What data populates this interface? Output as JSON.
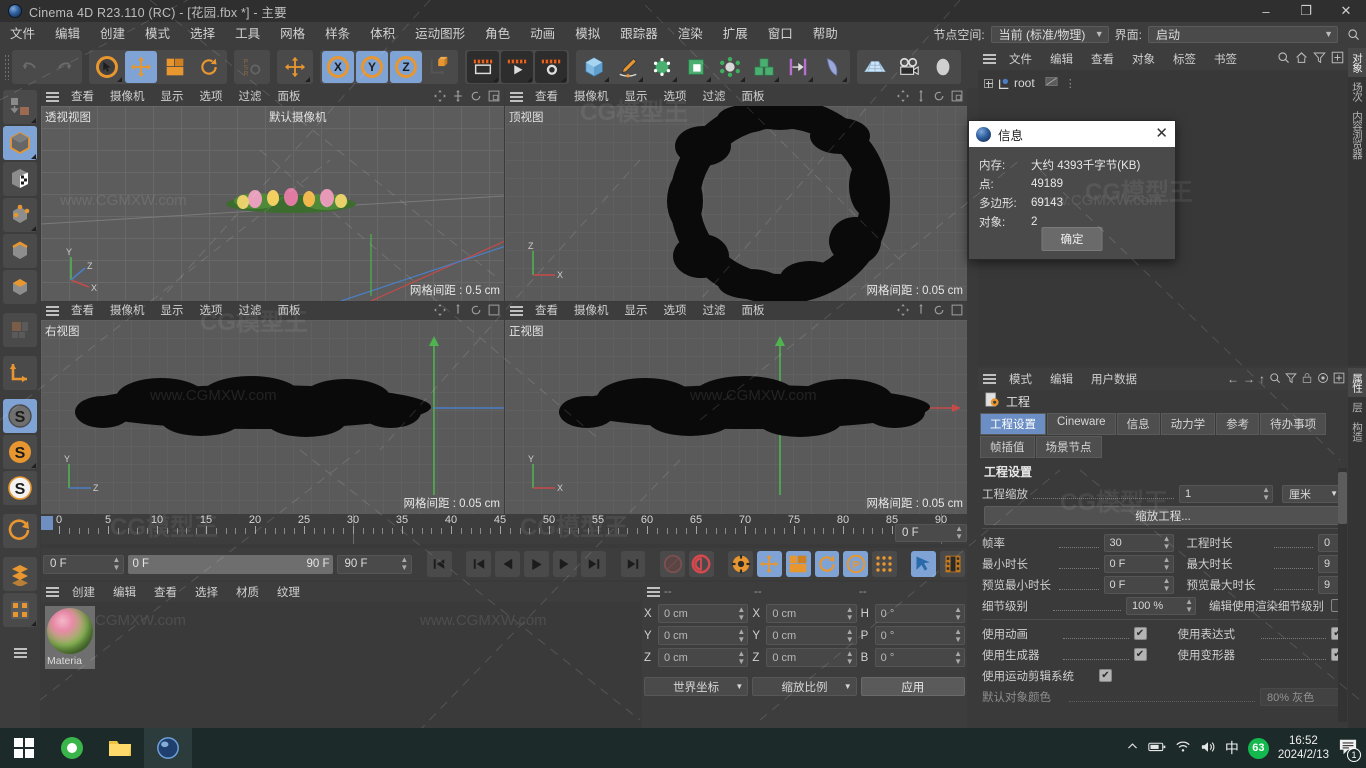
{
  "window": {
    "title": "Cinema 4D R23.110 (RC) - [花园.fbx *] - 主要",
    "minimize": "–",
    "maximize": "❐",
    "close": "✕"
  },
  "menubar": {
    "items": [
      "文件",
      "编辑",
      "创建",
      "模式",
      "选择",
      "工具",
      "网格",
      "样条",
      "体积",
      "运动图形",
      "角色",
      "动画",
      "模拟",
      "跟踪器",
      "渲染",
      "扩展",
      "窗口",
      "帮助"
    ],
    "node_space_label": "节点空间:",
    "node_space_value": "当前 (标准/物理)",
    "layout_label": "界面:",
    "layout_value": "启动",
    "search_icon": "search-icon"
  },
  "viewports": [
    {
      "name": "透视视图",
      "menus": [
        "查看",
        "摄像机",
        "显示",
        "选项",
        "过滤",
        "面板"
      ],
      "camera": "默认摄像机",
      "grid": "网格间距 : 0.5 cm"
    },
    {
      "name": "顶视图",
      "menus": [
        "查看",
        "摄像机",
        "显示",
        "选项",
        "过滤",
        "面板"
      ],
      "camera": "",
      "grid": "网格间距 : 0.05 cm"
    },
    {
      "name": "右视图",
      "menus": [
        "查看",
        "摄像机",
        "显示",
        "选项",
        "过滤",
        "面板"
      ],
      "camera": "",
      "grid": "网格间距 : 0.05 cm"
    },
    {
      "name": "正视图",
      "menus": [
        "查看",
        "摄像机",
        "显示",
        "选项",
        "过滤",
        "面板"
      ],
      "camera": "",
      "grid": "网格间距 : 0.05 cm"
    }
  ],
  "timeline": {
    "ticks": [
      "0",
      "5",
      "10",
      "15",
      "20",
      "25",
      "30",
      "35",
      "40",
      "45",
      "50",
      "55",
      "60",
      "65",
      "70",
      "75",
      "80",
      "85",
      "90"
    ],
    "current_frame": "0 F",
    "range_start": "0 F",
    "range_end": "90 F",
    "max_frame": "90 F",
    "right_frame": "0 F"
  },
  "material_manager": {
    "menus": [
      "创建",
      "编辑",
      "查看",
      "选择",
      "材质",
      "纹理"
    ],
    "materials": [
      {
        "name": "Materia"
      }
    ]
  },
  "coordinates": {
    "header": [
      "--",
      "--",
      "--"
    ],
    "rows": [
      {
        "pos_axis": "X",
        "pos": "0 cm",
        "size_axis": "X",
        "size": "0 cm",
        "rot_axis": "H",
        "rot": "0 °"
      },
      {
        "pos_axis": "Y",
        "pos": "0 cm",
        "size_axis": "Y",
        "size": "0 cm",
        "rot_axis": "P",
        "rot": "0 °"
      },
      {
        "pos_axis": "Z",
        "pos": "0 cm",
        "size_axis": "Z",
        "size": "0 cm",
        "rot_axis": "B",
        "rot": "0 °"
      }
    ],
    "coord_system": "世界坐标",
    "scale_mode": "缩放比例",
    "apply": "应用"
  },
  "object_manager": {
    "menus": [
      "文件",
      "编辑",
      "查看",
      "对象",
      "标签",
      "书签"
    ],
    "icons": [
      "search-icon",
      "home-icon",
      "filter-icon",
      "add-icon"
    ],
    "root_label": "root"
  },
  "attribute_manager": {
    "menus": [
      "模式",
      "编辑",
      "用户数据"
    ],
    "icons": [
      "back-icon",
      "forward-icon",
      "up-icon",
      "search-icon",
      "filter-icon",
      "lock-icon",
      "target-icon",
      "add-icon"
    ],
    "object_label": "工程",
    "tabs": [
      "工程设置",
      "Cineware",
      "信息",
      "动力学",
      "参考",
      "待办事项",
      "帧插值",
      "场景节点"
    ],
    "active_tab": "工程设置",
    "section_title": "工程设置",
    "project_scale_label": "工程缩放",
    "project_scale_value": "1",
    "project_scale_unit": "厘米",
    "scale_project_button": "缩放工程...",
    "fields": [
      {
        "label": "帧率",
        "value": "30",
        "label2": "工程时长",
        "value2": "0"
      },
      {
        "label": "最小时长",
        "value": "0 F",
        "label2": "最大时长",
        "value2": "9"
      },
      {
        "label": "预览最小时长",
        "value": "0 F",
        "label2": "预览最大时长",
        "value2": "9"
      }
    ],
    "lod_label": "细节级别",
    "lod_value": "100 %",
    "render_lod_label": "编辑使用渲染细节级别",
    "checks": [
      {
        "label": "使用动画",
        "checked": true,
        "label2": "使用表达式",
        "checked2": true
      },
      {
        "label": "使用生成器",
        "checked": true,
        "label2": "使用变形器",
        "checked2": true
      },
      {
        "label": "使用运动剪辑系统",
        "checked": true,
        "label2": "",
        "checked2": null
      }
    ],
    "last_label": "默认对象颜色",
    "last_value": "80% 灰色"
  },
  "right_tabs_top": [
    "对象",
    "场次",
    "内容浏览器"
  ],
  "right_tabs_bottom": [
    "属性",
    "层",
    "构造"
  ],
  "info_dialog": {
    "title": "信息",
    "close": "✕",
    "rows": [
      {
        "key": "内存:",
        "value": "大约 4393千字节(KB)"
      },
      {
        "key": "点:",
        "value": "49189"
      },
      {
        "key": "多边形:",
        "value": "69143"
      },
      {
        "key": "对象:",
        "value": "2"
      }
    ],
    "ok": "确定"
  },
  "toolbar": {
    "groups": [
      {
        "buttons": [
          {
            "name": "undo-icon",
            "glyph": "↶",
            "state": "disabled"
          },
          {
            "name": "redo-icon",
            "glyph": "↷",
            "state": "disabled"
          }
        ]
      },
      {
        "buttons": [
          {
            "name": "select-tool-icon",
            "glyph": "➤",
            "state": "normal"
          },
          {
            "name": "move-tool-icon",
            "glyph": "✥",
            "state": "selected"
          },
          {
            "name": "scale-tool-icon",
            "glyph": "▧",
            "state": "normal"
          },
          {
            "name": "rotate-tool-icon",
            "glyph": "⟳",
            "state": "normal"
          }
        ]
      },
      {
        "buttons": [
          {
            "name": "psr-icon",
            "glyph": "PSR",
            "state": "normal"
          },
          {
            "name": "move-axis-icon",
            "glyph": "✥",
            "state": "normal"
          }
        ]
      },
      {
        "buttons": [
          {
            "name": "lock-x-icon",
            "glyph": "X",
            "state": "selected"
          },
          {
            "name": "lock-y-icon",
            "glyph": "Y",
            "state": "selected"
          },
          {
            "name": "lock-z-icon",
            "glyph": "Z",
            "state": "selected"
          },
          {
            "name": "world-coord-icon",
            "glyph": "⬚",
            "state": "normal"
          }
        ]
      },
      {
        "buttons": [
          {
            "name": "render-view-icon",
            "glyph": "▭",
            "state": "dark"
          },
          {
            "name": "render-region-icon",
            "glyph": "▶",
            "state": "dark"
          },
          {
            "name": "render-settings-icon",
            "glyph": "⚙",
            "state": "dark"
          }
        ]
      },
      {
        "buttons": [
          {
            "name": "cube-primitive-icon",
            "glyph": "◻",
            "state": "normal"
          },
          {
            "name": "spline-pen-icon",
            "glyph": "✒",
            "state": "normal"
          },
          {
            "name": "nurbs-icon",
            "glyph": "◫",
            "state": "normal"
          },
          {
            "name": "array-icon",
            "glyph": "◧",
            "state": "normal"
          },
          {
            "name": "symmetry-icon",
            "glyph": "✣",
            "state": "normal"
          },
          {
            "name": "mograph-icon",
            "glyph": "▩",
            "state": "normal"
          },
          {
            "name": "deformer-icon",
            "glyph": "⊢",
            "state": "normal"
          },
          {
            "name": "field-icon",
            "glyph": "◗",
            "state": "normal"
          }
        ]
      },
      {
        "buttons": [
          {
            "name": "floor-icon",
            "glyph": "▤",
            "state": "normal"
          },
          {
            "name": "camera-icon",
            "glyph": "📷",
            "state": "normal"
          },
          {
            "name": "light-icon",
            "glyph": "◍",
            "state": "normal"
          }
        ]
      }
    ]
  },
  "left_toolbar": [
    {
      "name": "make-editable-icon",
      "state": "normal"
    },
    {
      "name": "model-mode-icon",
      "state": "selected"
    },
    {
      "name": "texture-mode-icon",
      "state": "normal"
    },
    {
      "name": "point-mode-icon",
      "state": "normal"
    },
    {
      "name": "edge-mode-icon",
      "state": "normal"
    },
    {
      "name": "polygon-mode-icon",
      "state": "normal"
    },
    {
      "name": "uv-mode-icon",
      "state": "disabled"
    },
    {
      "name": "axis-mode-icon",
      "state": "normal"
    },
    {
      "name": "snap-enable-icon",
      "state": "selected"
    },
    {
      "name": "snap-settings-icon",
      "state": "normal"
    },
    {
      "name": "quantize-icon",
      "state": "normal"
    },
    {
      "name": "workplane-icon",
      "state": "normal"
    },
    {
      "name": "layout-icon",
      "state": "normal"
    },
    {
      "name": "render-queue-icon",
      "state": "normal"
    }
  ],
  "transport": {
    "buttons": [
      {
        "name": "goto-start-button",
        "glyph": "|◀",
        "state": "normal"
      },
      {
        "name": "prev-keyframe-button",
        "glyph": "◀|",
        "state": "normal"
      },
      {
        "name": "step-back-button",
        "glyph": "◀",
        "state": "normal"
      },
      {
        "name": "play-button",
        "glyph": "▶",
        "state": "normal"
      },
      {
        "name": "step-forward-button",
        "glyph": "|▶",
        "state": "normal"
      },
      {
        "name": "next-keyframe-button",
        "glyph": "▶|",
        "state": "normal"
      },
      {
        "name": "goto-end-button",
        "glyph": "▶|",
        "state": "normal"
      },
      {
        "name": "autokey-button",
        "glyph": "◉",
        "state": "normal"
      },
      {
        "name": "record-button",
        "glyph": "◎",
        "state": "normal"
      },
      {
        "name": "keyframe-settings-button",
        "glyph": "⚙",
        "state": "normal"
      },
      {
        "name": "key-position-button",
        "glyph": "✥",
        "state": "selected"
      },
      {
        "name": "key-scale-button",
        "glyph": "▧",
        "state": "selected"
      },
      {
        "name": "key-rotation-button",
        "glyph": "⟳",
        "state": "selected"
      },
      {
        "name": "key-param-button",
        "glyph": "P",
        "state": "selected"
      },
      {
        "name": "key-pla-button",
        "glyph": "⣿",
        "state": "normal"
      },
      {
        "name": "sound-button",
        "glyph": "🔊",
        "state": "selected"
      },
      {
        "name": "timeline-button",
        "glyph": "🎞",
        "state": "normal"
      }
    ]
  },
  "taskbar": {
    "items": [
      "start-icon",
      "browser-icon",
      "explorer-icon",
      "c4d-icon"
    ],
    "tray": [
      "chevron-up-icon",
      "battery-icon",
      "wifi-icon",
      "volume-icon"
    ],
    "ime": "中",
    "badge": "63",
    "time": "16:52",
    "date": "2024/2/13",
    "notification_count": "1"
  },
  "colors": {
    "accent_blue": "#7ea3d4",
    "orange": "#e8962f",
    "panel": "#3d3d3d",
    "viewport": "#5a5a5a"
  }
}
